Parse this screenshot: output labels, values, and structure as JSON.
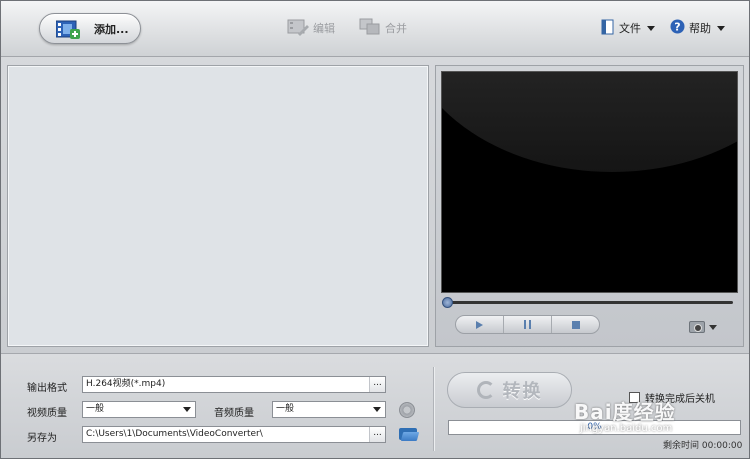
{
  "toolbar": {
    "add_label": "添加...",
    "edit_label": "编辑",
    "merge_label": "合并",
    "file_label": "文件",
    "help_label": "帮助"
  },
  "preview": {
    "seek_position": 0
  },
  "output": {
    "format_label": "输出格式",
    "format_value": "H.264视频(*.mp4)",
    "video_quality_label": "视频质量",
    "video_quality_value": "一般",
    "audio_quality_label": "音频质量",
    "audio_quality_value": "一般",
    "save_as_label": "另存为",
    "save_as_value": "C:\\Users\\1\\Documents\\VideoConverter\\",
    "browse_dots": "..."
  },
  "convert": {
    "button_label": "转换",
    "shutdown_label": "转换完成后关机",
    "progress_text": "0%",
    "progress_value": 0,
    "remaining_label": "剩余时间",
    "remaining_value": "00:00:00"
  },
  "watermark": {
    "line1": "Bai度经验",
    "line2": "jingyan.baidu.com"
  },
  "colors": {
    "accent": "#2c5fa8",
    "screen_bg": "#000000"
  }
}
